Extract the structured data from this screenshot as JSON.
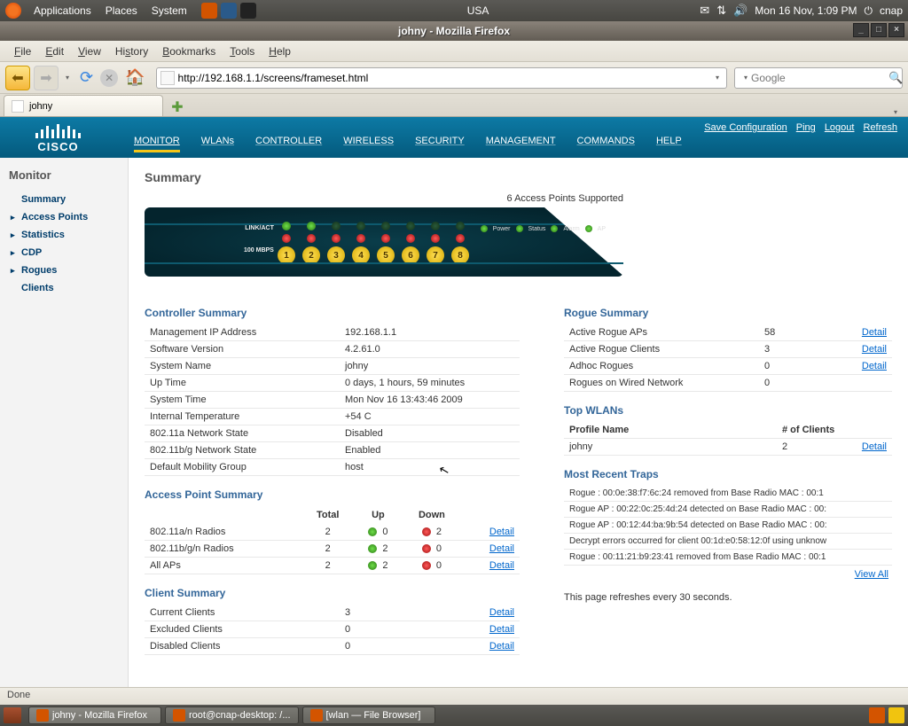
{
  "gnome": {
    "menus": [
      "Applications",
      "Places",
      "System"
    ],
    "center": "USA",
    "clock": "Mon 16 Nov,  1:09 PM",
    "user": "cnap"
  },
  "window": {
    "title": "johny - Mozilla Firefox"
  },
  "ff_menu": [
    "File",
    "Edit",
    "View",
    "History",
    "Bookmarks",
    "Tools",
    "Help"
  ],
  "url": "http://192.168.1.1/screens/frameset.html",
  "search_placeholder": "Google",
  "tab_title": "johny",
  "cisco": {
    "nav": [
      "MONITOR",
      "WLANs",
      "CONTROLLER",
      "WIRELESS",
      "SECURITY",
      "MANAGEMENT",
      "COMMANDS",
      "HELP"
    ],
    "right_links": [
      "Save Configuration",
      "Ping",
      "Logout",
      "Refresh"
    ],
    "logo_text": "CISCO"
  },
  "sidebar": {
    "title": "Monitor",
    "items": [
      {
        "label": "Summary",
        "arrow": false,
        "bold": true
      },
      {
        "label": "Access Points",
        "arrow": true,
        "bold": true
      },
      {
        "label": "Statistics",
        "arrow": true,
        "bold": true
      },
      {
        "label": "CDP",
        "arrow": true,
        "bold": true
      },
      {
        "label": "Rogues",
        "arrow": true,
        "bold": true
      },
      {
        "label": "Clients",
        "arrow": false,
        "bold": true
      }
    ]
  },
  "page": {
    "title": "Summary",
    "ap_supported": "6 Access Points Supported",
    "switch_labels": {
      "top": "LINK/ACT",
      "bottom": "100 MBPS"
    },
    "status_labels": [
      "Power",
      "Status",
      "Alarm",
      "AP"
    ]
  },
  "controller_summary": {
    "title": "Controller Summary",
    "rows": [
      [
        "Management IP Address",
        "192.168.1.1"
      ],
      [
        "Software Version",
        "4.2.61.0"
      ],
      [
        "System Name",
        "johny"
      ],
      [
        "Up Time",
        "0 days, 1 hours, 59 minutes"
      ],
      [
        "System Time",
        "Mon Nov 16 13:43:46 2009"
      ],
      [
        "Internal Temperature",
        "+54 C"
      ],
      [
        "802.11a Network State",
        "Disabled"
      ],
      [
        "802.11b/g Network State",
        "Enabled"
      ],
      [
        "Default Mobility Group",
        "host"
      ]
    ]
  },
  "ap_summary": {
    "title": "Access Point Summary",
    "headers": [
      "",
      "Total",
      "Up",
      "Down",
      ""
    ],
    "rows": [
      {
        "name": "802.11a/n Radios",
        "total": "2",
        "up": "0",
        "down": "2",
        "up_color": "green",
        "down_color": "red",
        "link": "Detail"
      },
      {
        "name": "802.11b/g/n Radios",
        "total": "2",
        "up": "2",
        "down": "0",
        "up_color": "green",
        "down_color": "red",
        "link": "Detail"
      },
      {
        "name": "All APs",
        "total": "2",
        "up": "2",
        "down": "0",
        "up_color": "green",
        "down_color": "red",
        "link": "Detail"
      }
    ]
  },
  "client_summary": {
    "title": "Client Summary",
    "rows": [
      {
        "name": "Current Clients",
        "value": "3",
        "link": "Detail"
      },
      {
        "name": "Excluded Clients",
        "value": "0",
        "link": "Detail"
      },
      {
        "name": "Disabled Clients",
        "value": "0",
        "link": "Detail"
      }
    ]
  },
  "rogue_summary": {
    "title": "Rogue Summary",
    "rows": [
      {
        "name": "Active Rogue APs",
        "value": "58",
        "link": "Detail"
      },
      {
        "name": "Active Rogue Clients",
        "value": "3",
        "link": "Detail"
      },
      {
        "name": "Adhoc Rogues",
        "value": "0",
        "link": "Detail"
      },
      {
        "name": "Rogues on Wired Network",
        "value": "0",
        "link": ""
      }
    ]
  },
  "top_wlans": {
    "title": "Top WLANs",
    "headers": [
      "Profile Name",
      "# of Clients",
      ""
    ],
    "rows": [
      {
        "name": "johny",
        "clients": "2",
        "link": "Detail"
      }
    ]
  },
  "traps": {
    "title": "Most Recent Traps",
    "items": [
      "Rogue : 00:0e:38:f7:6c:24  removed from Base Radio MAC : 00:1",
      "Rogue AP : 00:22:0c:25:4d:24 detected on Base Radio MAC : 00:",
      "Rogue AP : 00:12:44:ba:9b:54 detected on Base Radio MAC : 00:",
      "Decrypt errors occurred for client 00:1d:e0:58:12:0f using unknow",
      "Rogue : 00:11:21:b9:23:41  removed from Base Radio MAC : 00:1"
    ],
    "view_all": "View All",
    "refresh_note": "This page refreshes every 30 seconds."
  },
  "statusbar": "Done",
  "taskbar": [
    {
      "label": "johny - Mozilla Firefox",
      "active": true
    },
    {
      "label": "root@cnap-desktop: /...",
      "active": false
    },
    {
      "label": "[wlan — File Browser]",
      "active": false
    }
  ]
}
